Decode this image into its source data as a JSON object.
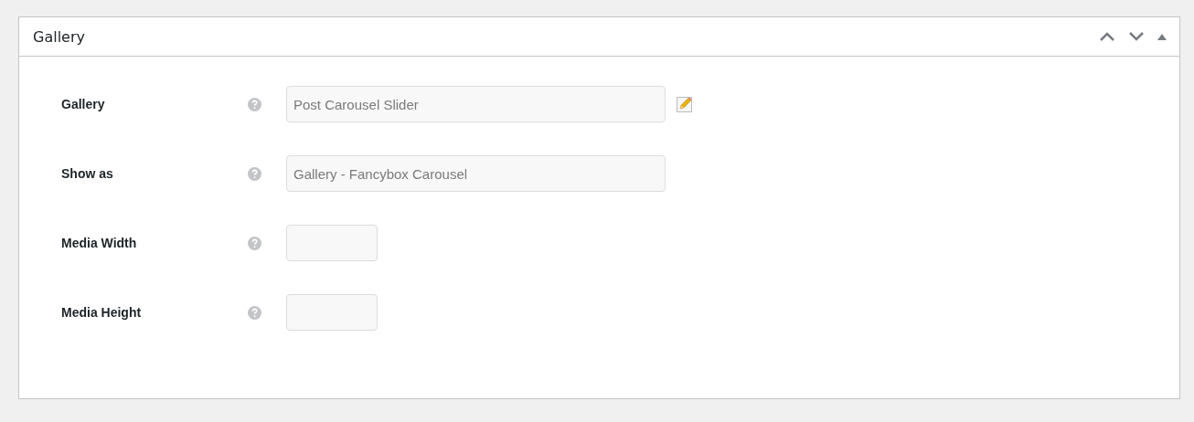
{
  "panel": {
    "title": "Gallery"
  },
  "fields": [
    {
      "label": "Gallery",
      "kind": "wide",
      "value": "Post Carousel Slider",
      "edit_icon": true
    },
    {
      "label": "Show as",
      "kind": "wide",
      "value": "Gallery - Fancybox Carousel",
      "edit_icon": false
    },
    {
      "label": "Media Width",
      "kind": "small",
      "edit_icon": false
    },
    {
      "label": "Media Height",
      "kind": "small",
      "edit_icon": false
    }
  ]
}
